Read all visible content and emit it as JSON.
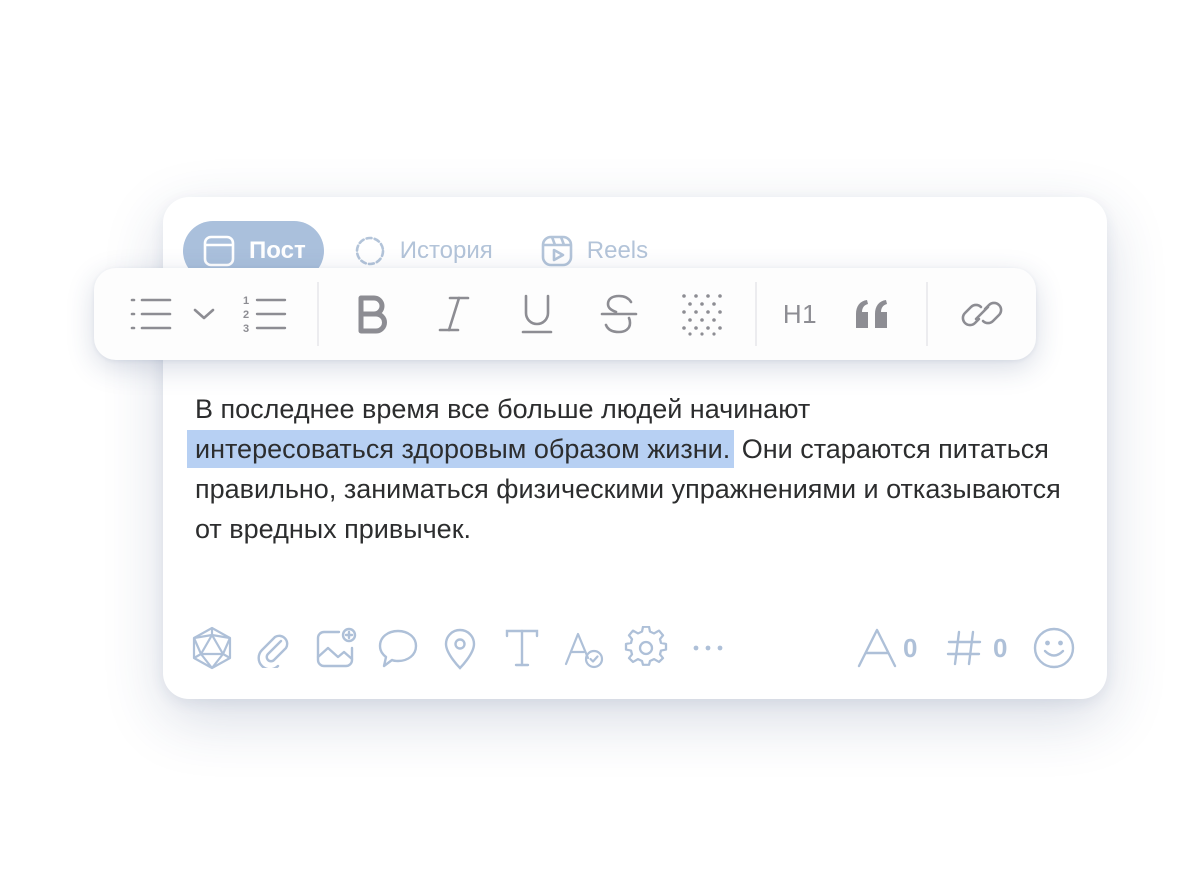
{
  "tabs": [
    {
      "label": "Пост",
      "icon": "post-icon",
      "active": true
    },
    {
      "label": "История",
      "icon": "story-icon",
      "active": false
    },
    {
      "label": "Reels",
      "icon": "reels-icon",
      "active": false
    }
  ],
  "toolbar": {
    "buttons": [
      "bulleted-list-icon",
      "chevron-down-icon",
      "numbered-list-icon",
      "bold-icon",
      "italic-icon",
      "underline-icon",
      "strikethrough-icon",
      "spoiler-icon",
      "heading-button",
      "quote-icon",
      "link-icon"
    ],
    "heading_label": "H1"
  },
  "editor": {
    "text_before": "В последнее время все больше людей начинают",
    "selected_text": "интересоваться здоровым образом жизни.",
    "text_after": " Они стараются питаться правильно, заниматься физическими упражнениями и отказываются от вредных привычек."
  },
  "bottom_bar": {
    "icons": [
      "poll-icon",
      "attach-icon",
      "add-image-icon",
      "comment-icon",
      "location-icon",
      "text-style-icon",
      "font-check-icon",
      "settings-icon",
      "more-icon"
    ],
    "char_counter": "0",
    "hashtag_counter": "0",
    "emoji_icon": "emoji-icon"
  },
  "colors": {
    "accent": "#aac0dc",
    "icon": "#aec0d8",
    "toolbar_icon": "#8d8d93",
    "selection": "#b7d0f3",
    "text": "#2c2d2e"
  }
}
